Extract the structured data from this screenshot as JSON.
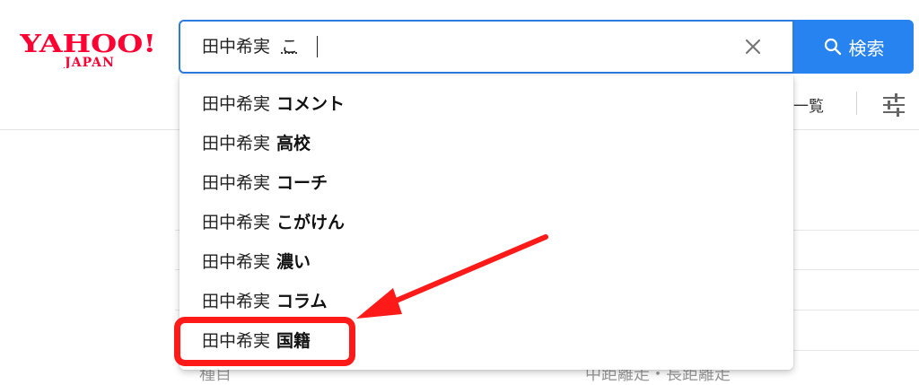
{
  "logo": {
    "main": "YAHOO!",
    "sub": "JAPAN"
  },
  "search": {
    "query": "田中希実",
    "composing": "こ",
    "clear_icon": "close-icon",
    "button_label": "検索",
    "button_icon": "search-icon"
  },
  "subnav": {
    "list_label": "一覧",
    "filter_icon": "sliders-icon"
  },
  "suggestions": [
    {
      "prefix": "田中希実",
      "rest": "コメント"
    },
    {
      "prefix": "田中希実",
      "rest": "高校"
    },
    {
      "prefix": "田中希実",
      "rest": "コーチ"
    },
    {
      "prefix": "田中希実",
      "rest": "こがけん"
    },
    {
      "prefix": "田中希実",
      "rest": "濃い"
    },
    {
      "prefix": "田中希実",
      "rest": "コラム"
    },
    {
      "prefix": "田中希実",
      "rest": "国籍"
    }
  ],
  "background": {
    "left_text": "種目",
    "right_text": "中距離走・長距離走"
  },
  "colors": {
    "accent": "#2683f0",
    "annotation": "#ff1a1a",
    "logo": "#ff0033"
  }
}
